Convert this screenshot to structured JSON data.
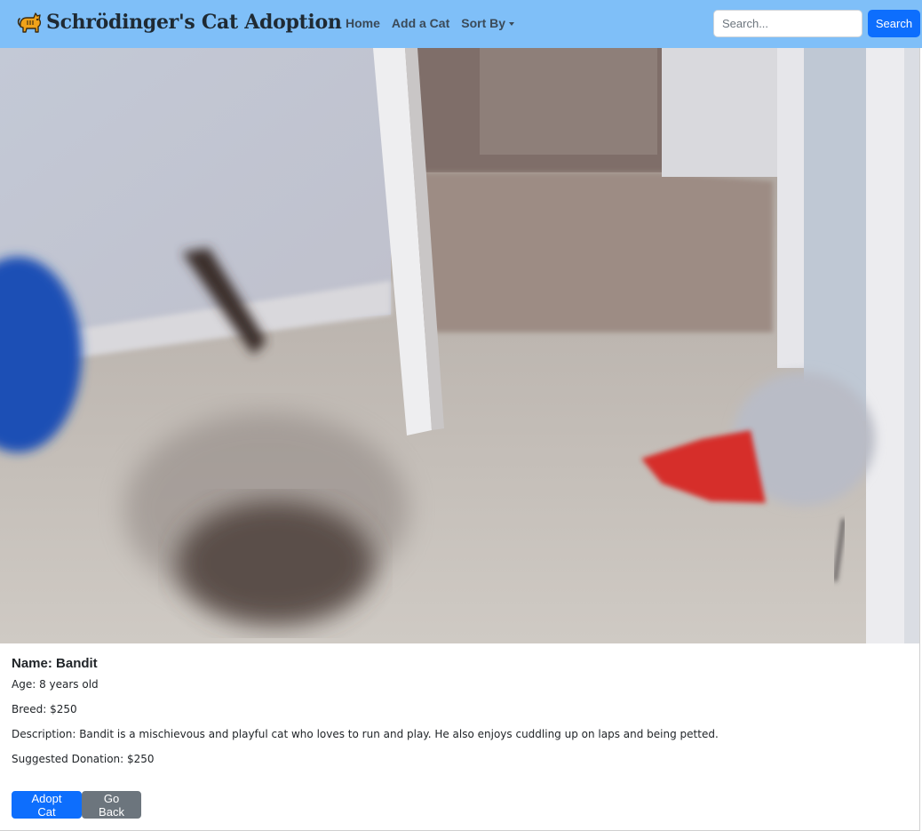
{
  "navbar": {
    "brand_icon": "cat-icon",
    "brand_title": "Schrödinger's Cat Adoption",
    "links": [
      {
        "label": "Home"
      },
      {
        "label": "Add a Cat"
      },
      {
        "label": "Sort By"
      }
    ],
    "search": {
      "placeholder": "Search...",
      "value": "",
      "button_label": "Search"
    },
    "background_color": "#7fbff8"
  },
  "cat": {
    "photo_icon": "cat-photo",
    "name_line": "Name: Bandit",
    "age_line": "Age: 8 years old",
    "breed_line": "Breed: $250",
    "description_line": "Description: Bandit is a mischievous and playful cat who loves to run and play. He also enjoys cuddling up on laps and being petted.",
    "donation_line": "Suggested Donation: $250"
  },
  "actions": {
    "adopt_label": "Adopt Cat",
    "back_label": "Go Back"
  },
  "colors": {
    "primary": "#0d6efd",
    "secondary": "#6c757d"
  }
}
